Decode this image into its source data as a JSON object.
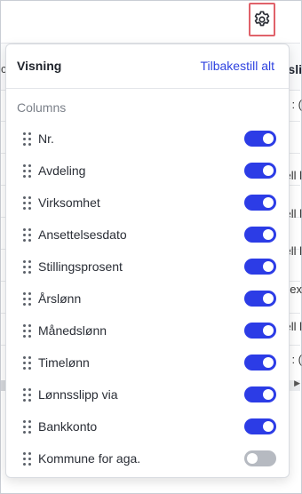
{
  "settings_button": {
    "icon": "gear-icon"
  },
  "background_table": {
    "header_fragment": "sli",
    "left_glyph": "c",
    "row_fragments": [
      ": (",
      "ell l",
      "ell l",
      "ell l",
      "ell l",
      "ex",
      "ell l",
      ": ("
    ]
  },
  "panel": {
    "title": "Visning",
    "reset_label": "Tilbakestill alt",
    "section_label": "Columns",
    "columns": [
      {
        "label": "Nr.",
        "enabled": true
      },
      {
        "label": "Avdeling",
        "enabled": true
      },
      {
        "label": "Virksomhet",
        "enabled": true
      },
      {
        "label": "Ansettelsesdato",
        "enabled": true
      },
      {
        "label": "Stillingsprosent",
        "enabled": true
      },
      {
        "label": "Årslønn",
        "enabled": true
      },
      {
        "label": "Månedslønn",
        "enabled": true
      },
      {
        "label": "Timelønn",
        "enabled": true
      },
      {
        "label": "Lønnsslipp via",
        "enabled": true
      },
      {
        "label": "Bankkonto",
        "enabled": true
      },
      {
        "label": "Kommune for aga.",
        "enabled": false
      }
    ]
  },
  "colors": {
    "accent": "#2c3ce6",
    "toggle_off": "#b6bac1",
    "highlight_border": "#e0626a"
  }
}
